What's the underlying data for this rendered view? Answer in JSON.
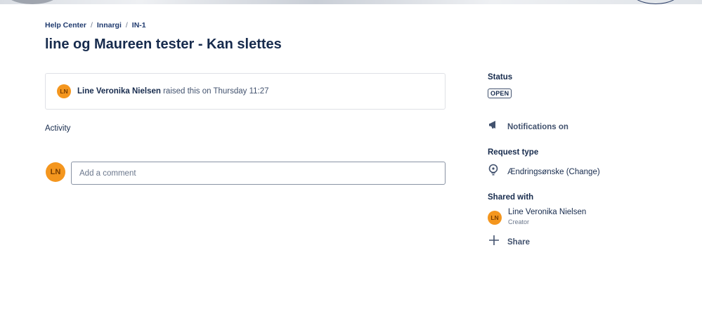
{
  "breadcrumb": {
    "items": [
      "Help Center",
      "Innargi",
      "IN-1"
    ],
    "separator": "/"
  },
  "title": "line og Maureen tester - Kan slettes",
  "request": {
    "avatar_initials": "LN",
    "reporter": "Line Veronika Nielsen",
    "raised_text": "raised this on Thursday 11:27"
  },
  "activity": {
    "label": "Activity",
    "avatar_initials": "LN",
    "comment_placeholder": "Add a comment"
  },
  "sidebar": {
    "status_heading": "Status",
    "status_value": "OPEN",
    "notifications_label": "Notifications on",
    "request_type_heading": "Request type",
    "request_type_value": "Ændringsønske (Change)",
    "shared_with_heading": "Shared with",
    "shared_person_initials": "LN",
    "shared_person_name": "Line Veronika Nielsen",
    "shared_person_role": "Creator",
    "share_label": "Share"
  },
  "colors": {
    "avatar": "#f4961e",
    "title": "#172b4d",
    "breadcrumb": "#1f3a6e"
  },
  "icons": {
    "notifications": "megaphone-icon",
    "request_type": "lightbulb-icon",
    "share": "plus-icon"
  }
}
